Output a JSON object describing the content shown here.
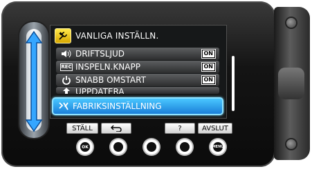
{
  "header": {
    "icon": "tools-icon",
    "title": "VANLIGA INSTÄLLN."
  },
  "menu": {
    "items": [
      {
        "icon": "speaker-icon",
        "label": "DRIFTSLJUD",
        "status": "ON"
      },
      {
        "icon": "rec-icon",
        "icon_text": "REC",
        "label": "INSPELN.KNAPP",
        "status": "ON"
      },
      {
        "icon": "power-icon",
        "label": "SNABB OMSTART",
        "status": "ON"
      },
      {
        "icon": "update-icon",
        "label": "UPPDATERA",
        "status": ""
      },
      {
        "icon": "factory-reset-icon",
        "label": "FABRIKSINSTÄLLNING",
        "status": "",
        "selected": true
      }
    ]
  },
  "softkeys": {
    "set": "STÄLL",
    "back_icon": "return-arrow-icon",
    "help": "?",
    "exit": "AVSLUT"
  },
  "hw_buttons": {
    "ok": "OK",
    "menu": "MENU"
  },
  "colors": {
    "selected": "#2a9ff0",
    "header_icon": "#f1cf1a",
    "screen_bg": "#161819"
  }
}
